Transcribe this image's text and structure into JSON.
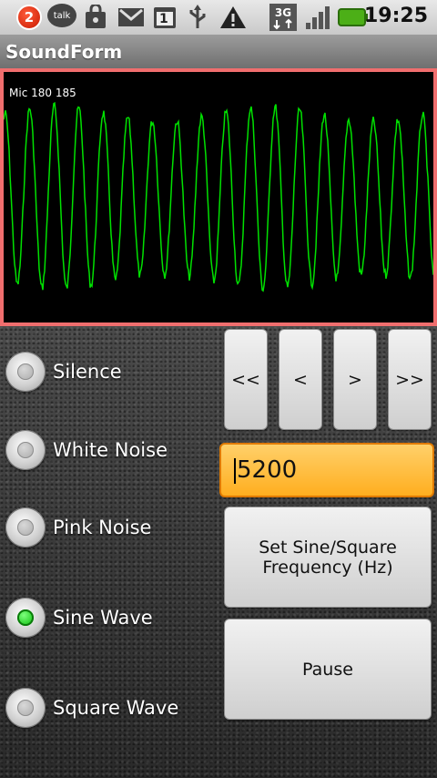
{
  "status_bar": {
    "notification_count": "2",
    "talk_label": "talk",
    "network_label": "3G",
    "time": "19:25",
    "icons": [
      "notification-badge-icon",
      "talk-icon",
      "shopping-bag-icon",
      "gmail-icon",
      "calendar-icon",
      "usb-icon",
      "warning-icon",
      "3g-icon",
      "signal-icon",
      "battery-icon"
    ],
    "calendar_day": "1"
  },
  "app": {
    "title": "SoundForm"
  },
  "scope": {
    "label": "Mic 180 185",
    "trace_color": "#00e000",
    "border_color": "#f06e6e"
  },
  "radios": [
    {
      "label": "Silence",
      "checked": false
    },
    {
      "label": "White Noise",
      "checked": false
    },
    {
      "label": "Pink Noise",
      "checked": false
    },
    {
      "label": "Sine Wave",
      "checked": true
    },
    {
      "label": "Square Wave",
      "checked": false
    }
  ],
  "step_buttons": [
    "<<",
    "<",
    ">",
    ">>"
  ],
  "frequency": {
    "value": "5200"
  },
  "set_freq_button": "Set Sine/Square Frequency (Hz)",
  "pause_button": "Pause"
}
